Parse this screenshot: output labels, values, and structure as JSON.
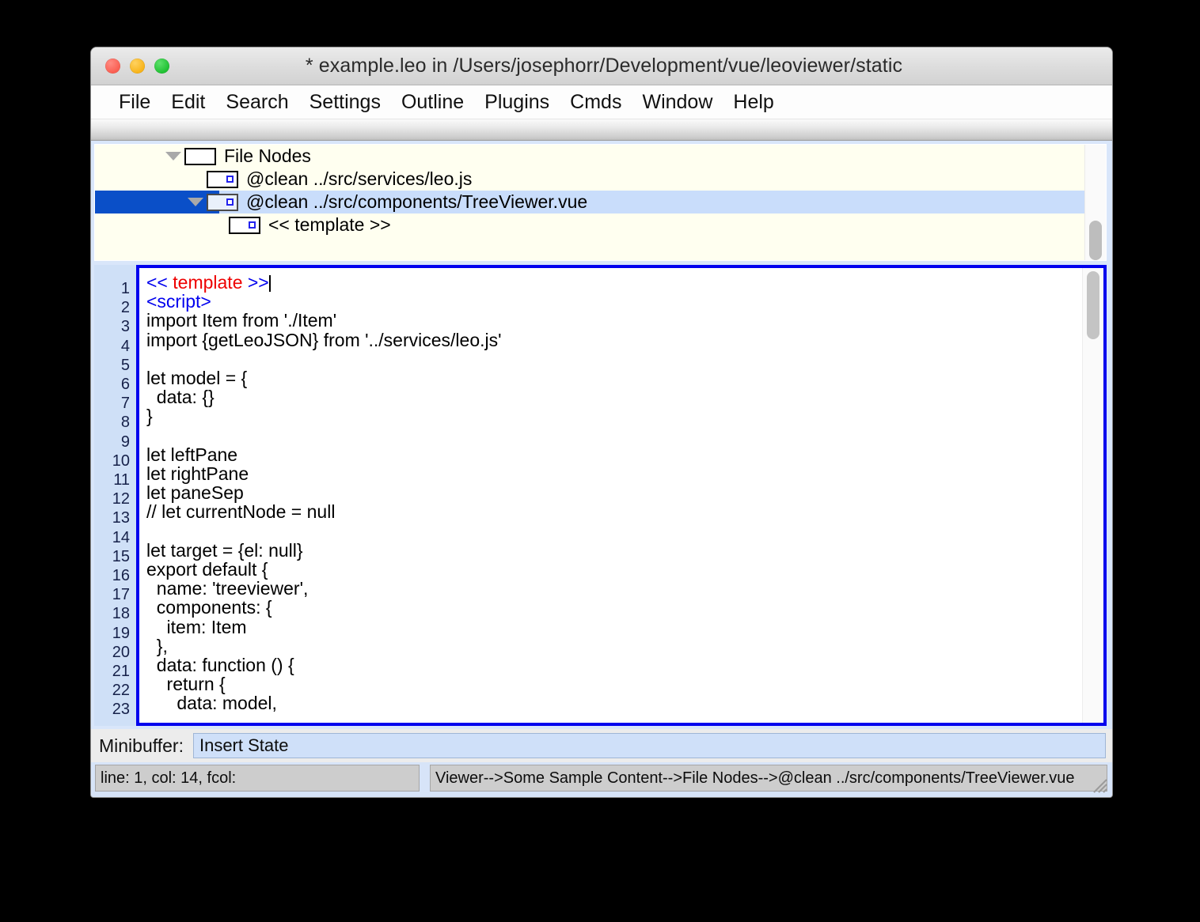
{
  "window": {
    "title": "* example.leo in /Users/josephorr/Development/vue/leoviewer/static",
    "controls": [
      "close",
      "minimize",
      "maximize"
    ]
  },
  "menubar": {
    "items": [
      {
        "label": "File"
      },
      {
        "label": "Edit"
      },
      {
        "label": "Search"
      },
      {
        "label": "Settings"
      },
      {
        "label": "Outline"
      },
      {
        "label": "Plugins"
      },
      {
        "label": "Cmds"
      },
      {
        "label": "Window"
      },
      {
        "label": "Help"
      }
    ]
  },
  "tree": {
    "rows": [
      {
        "label": "File Nodes",
        "indent": 85,
        "arrow": true,
        "icon": "node-box-plain",
        "selected": false
      },
      {
        "label": "@clean ../src/services/leo.js",
        "indent": 113,
        "arrow": false,
        "icon": "node-box-marked",
        "selected": false
      },
      {
        "label": "@clean ../src/components/TreeViewer.vue",
        "indent": 113,
        "arrow": true,
        "icon": "node-box-dirty",
        "selected": true
      },
      {
        "label": "<< template >>",
        "indent": 141,
        "arrow": false,
        "icon": "node-box-marked",
        "selected": false
      }
    ]
  },
  "editor": {
    "line_numbers": [
      "1",
      "2",
      "3",
      "4",
      "5",
      "6",
      "7",
      "8",
      "9",
      "10",
      "11",
      "12",
      "13",
      "14",
      "15",
      "16",
      "17",
      "18",
      "19",
      "20",
      "21",
      "22",
      "23"
    ],
    "lines": [
      "<< template >>",
      "<script>",
      "import Item from './Item'",
      "import {getLeoJSON} from '../services/leo.js'",
      "",
      "let model = {",
      "  data: {}",
      "}",
      "",
      "let leftPane",
      "let rightPane",
      "let paneSep",
      "// let currentNode = null",
      "",
      "let target = {el: null}",
      "export default {",
      "  name: 'treeviewer',",
      "  components: {",
      "    item: Item",
      "  },",
      "  data: function () {",
      "    return {",
      "      data: model,"
    ],
    "colors": {
      "keyword": "#0000ee",
      "section": "#ee0000",
      "border": "#0000ee"
    }
  },
  "minibuffer": {
    "label": "Minibuffer:",
    "value": "Insert State",
    "placeholder": ""
  },
  "statusbar": {
    "left": "line: 1, col: 14, fcol:",
    "right": "Viewer-->Some Sample Content-->File Nodes-->@clean ../src/components/TreeViewer.vue"
  }
}
